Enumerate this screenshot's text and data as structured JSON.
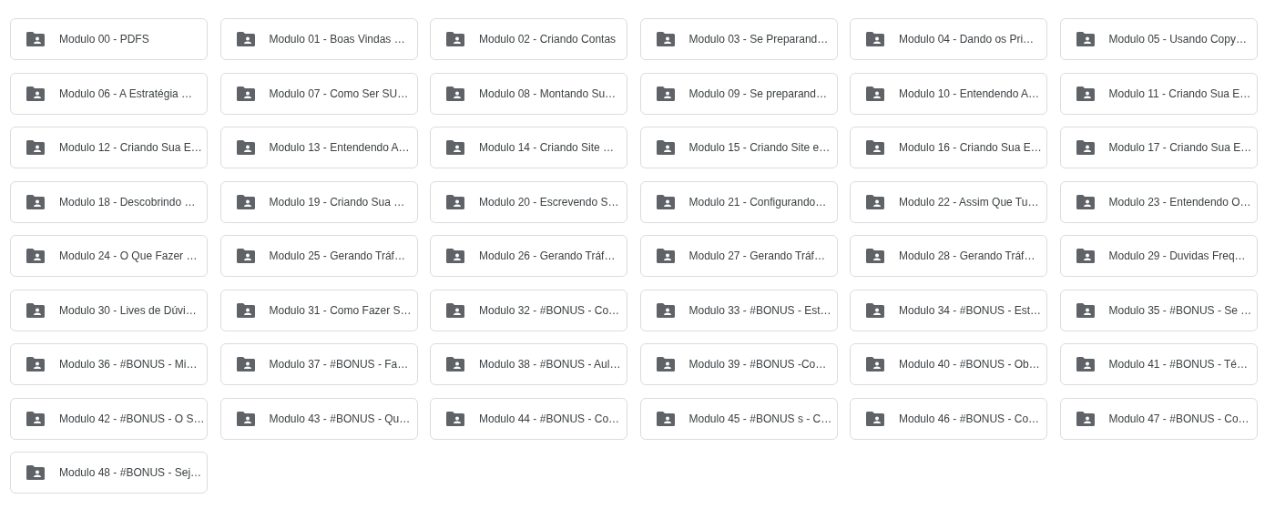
{
  "folders": [
    {
      "name": "Modulo 00 - PDFS"
    },
    {
      "name": "Modulo 01 - Boas Vindas …"
    },
    {
      "name": "Modulo 02 - Criando Contas"
    },
    {
      "name": "Modulo 03 - Se Preparand…"
    },
    {
      "name": "Modulo 04 - Dando os Pri…"
    },
    {
      "name": "Modulo 05 - Usando Copy…"
    },
    {
      "name": "Modulo 06 - A Estratégia …"
    },
    {
      "name": "Modulo 07 - Como Ser SU…"
    },
    {
      "name": "Modulo 08 - Montando Su…"
    },
    {
      "name": "Modulo 09 - Se preparand…"
    },
    {
      "name": "Modulo 10 - Entendendo A…"
    },
    {
      "name": "Modulo 11 - Criando Sua E…"
    },
    {
      "name": "Modulo 12 - Criando Sua E…"
    },
    {
      "name": "Modulo 13 - Entendendo A…"
    },
    {
      "name": "Modulo 14 - Criando Site …"
    },
    {
      "name": "Modulo 15 - Criando Site e…"
    },
    {
      "name": "Modulo 16 - Criando Sua E…"
    },
    {
      "name": "Modulo 17 - Criando Sua E…"
    },
    {
      "name": "Modulo 18 - Descobrindo …"
    },
    {
      "name": "Modulo 19 - Criando Sua …"
    },
    {
      "name": "Modulo 20 - Escrevendo S…"
    },
    {
      "name": "Modulo 21 - Configurando…"
    },
    {
      "name": "Modulo 22 - Assim Que Tu…"
    },
    {
      "name": "Modulo 23 - Entendendo O…"
    },
    {
      "name": "Modulo 24 - O Que Fazer …"
    },
    {
      "name": "Modulo 25 - Gerando Tráf…"
    },
    {
      "name": "Modulo 26 - Gerando Tráf…"
    },
    {
      "name": "Modulo 27 - Gerando Tráf…"
    },
    {
      "name": "Modulo 28 - Gerando Tráf…"
    },
    {
      "name": "Modulo 29 - Duvidas Freq…"
    },
    {
      "name": "Modulo 30 - Lives de Dúvi…"
    },
    {
      "name": "Modulo 31 - Como Fazer S…"
    },
    {
      "name": "Modulo 32 - #BONUS - Co…"
    },
    {
      "name": "Modulo 33 - #BONUS - Est…"
    },
    {
      "name": "Modulo 34 - #BONUS - Est…"
    },
    {
      "name": "Modulo 35 - #BONUS - Se …"
    },
    {
      "name": "Modulo 36 - #BONUS - Mi…"
    },
    {
      "name": "Modulo 37 - #BONUS - Fa…"
    },
    {
      "name": "Modulo 38 - #BONUS - Aul…"
    },
    {
      "name": "Modulo 39 - #BONUS -Co…"
    },
    {
      "name": "Modulo 40 - #BONUS - Ob…"
    },
    {
      "name": "Modulo 41 - #BONUS - Té…"
    },
    {
      "name": "Modulo 42 - #BONUS - O S…"
    },
    {
      "name": "Modulo 43 - #BONUS - Qu…"
    },
    {
      "name": "Modulo 44 - #BONUS - Co…"
    },
    {
      "name": "Modulo 45 - #BONUS s - C…"
    },
    {
      "name": "Modulo 46 - #BONUS - Co…"
    },
    {
      "name": "Modulo 47 - #BONUS - Co…"
    },
    {
      "name": "Modulo 48 - #BONUS - Sej…"
    }
  ]
}
